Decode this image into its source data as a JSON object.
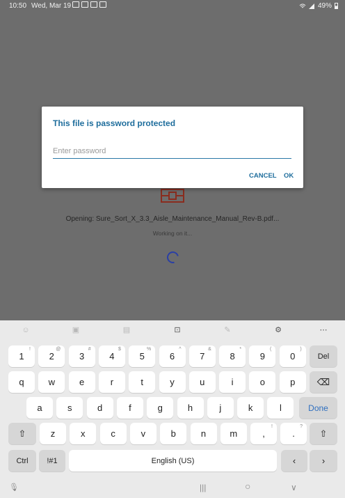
{
  "status_bar": {
    "time": "10:50",
    "date": "Wed, Mar 19",
    "battery": "49%"
  },
  "background": {
    "opening_text": "Opening: Sure_Sort_X_3.3_Aisle_Maintenance_Manual_Rev-B.pdf...",
    "working_text": "Working on it..."
  },
  "dialog": {
    "title": "This file is password protected",
    "input_placeholder": "Enter password",
    "input_value": "",
    "cancel_label": "CANCEL",
    "ok_label": "OK"
  },
  "keyboard": {
    "toolbar_icons": [
      "emoji-icon",
      "sticker-icon",
      "clipboard-icon",
      "keyboard-mode-icon",
      "handwriting-icon",
      "settings-icon",
      "more-icon"
    ],
    "row1": [
      {
        "label": "1",
        "sup": "!"
      },
      {
        "label": "2",
        "sup": "@"
      },
      {
        "label": "3",
        "sup": "#"
      },
      {
        "label": "4",
        "sup": "$"
      },
      {
        "label": "5",
        "sup": "%"
      },
      {
        "label": "6",
        "sup": "^"
      },
      {
        "label": "7",
        "sup": "&"
      },
      {
        "label": "8",
        "sup": "*"
      },
      {
        "label": "9",
        "sup": "("
      },
      {
        "label": "0",
        "sup": ")"
      }
    ],
    "del_label": "Del",
    "row2": [
      "q",
      "w",
      "e",
      "r",
      "t",
      "y",
      "u",
      "i",
      "o",
      "p"
    ],
    "row3": [
      "a",
      "s",
      "d",
      "f",
      "g",
      "h",
      "j",
      "k",
      "l"
    ],
    "done_label": "Done",
    "row4": [
      "z",
      "x",
      "c",
      "v",
      "b",
      "n",
      "m"
    ],
    "comma": {
      "label": ",",
      "sup": "!"
    },
    "period": {
      "label": ".",
      "sup": "?"
    },
    "ctrl_label": "Ctrl",
    "symbols_label": "!#1",
    "space_label": "English (US)",
    "left_arrow": "‹",
    "right_arrow": "›"
  },
  "nav_bar": {
    "mic": "🎙",
    "recents": "|||",
    "home": "○",
    "back": "∨"
  }
}
